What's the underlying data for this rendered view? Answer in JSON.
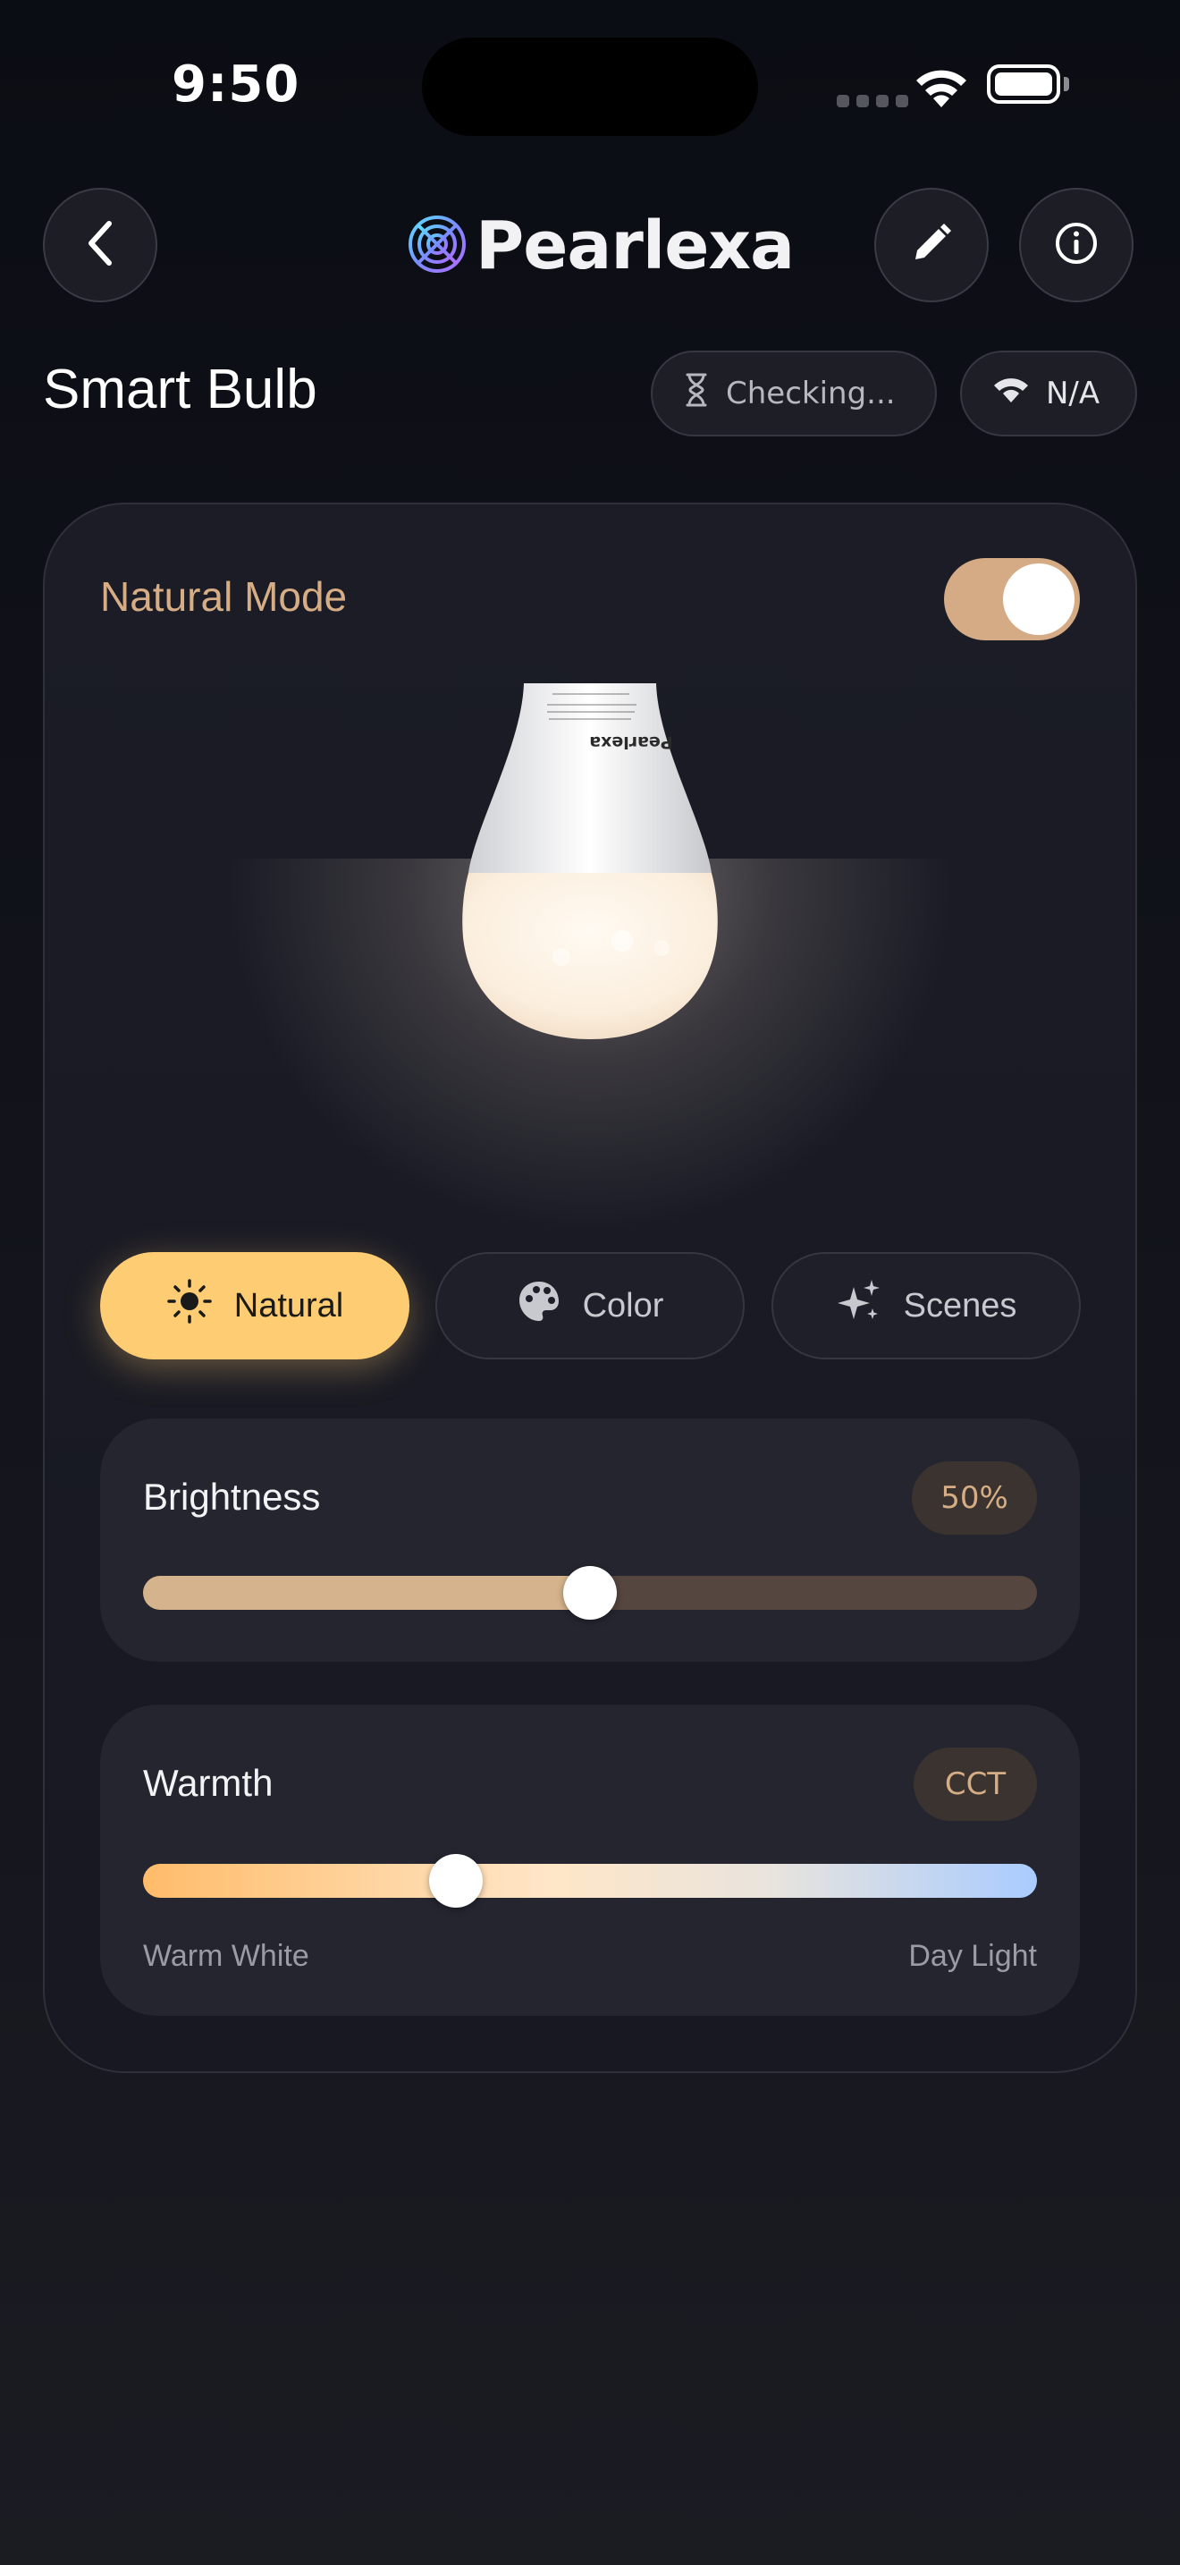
{
  "status_bar": {
    "time": "9:50"
  },
  "header": {
    "logo_text": "Pearlexa",
    "back_icon": "chevron-left-icon",
    "edit_icon": "pencil-icon",
    "info_icon": "info-icon"
  },
  "device": {
    "title": "Smart Bulb",
    "status_label": "Checking...",
    "wifi_label": "N/A"
  },
  "mode": {
    "label": "Natural Mode",
    "toggle_on": true
  },
  "bulb": {
    "brand_text": "Pearlexa"
  },
  "tabs": [
    {
      "label": "Natural",
      "icon": "sun-icon",
      "active": true
    },
    {
      "label": "Color",
      "icon": "palette-icon",
      "active": false
    },
    {
      "label": "Scenes",
      "icon": "sparkles-icon",
      "active": false
    }
  ],
  "brightness": {
    "label": "Brightness",
    "value_label": "50%",
    "value": 0.5
  },
  "warmth": {
    "label": "Warmth",
    "badge": "CCT",
    "value": 0.35,
    "min_label": "Warm White",
    "max_label": "Day Light"
  },
  "colors": {
    "accent": "#fecc73",
    "mode_label": "#d6ad85",
    "brightness_fill": "#d5b38c",
    "warm_start": "#ffbc6a",
    "warm_end": "#a9ccff"
  }
}
